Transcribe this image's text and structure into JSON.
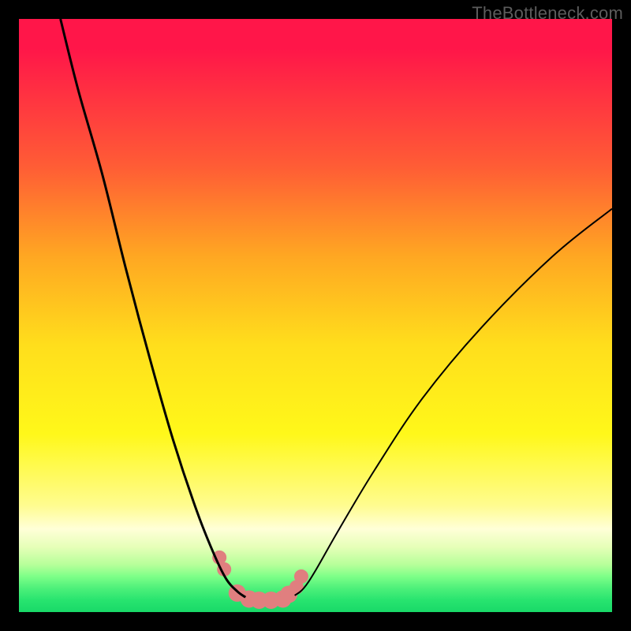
{
  "watermark": {
    "text": "TheBottleneck.com"
  },
  "chart_data": {
    "type": "line",
    "title": "",
    "xlabel": "",
    "ylabel": "",
    "xlim": [
      0,
      100
    ],
    "ylim": [
      0,
      100
    ],
    "grid": false,
    "legend": false,
    "series": [
      {
        "name": "left-curve",
        "x": [
          7,
          10,
          14,
          18,
          22,
          26,
          30,
          33,
          35,
          36.8,
          38.2
        ],
        "y": [
          100,
          88,
          74,
          58,
          43,
          29,
          17,
          9.5,
          5.5,
          3.5,
          2.5
        ]
      },
      {
        "name": "right-curve",
        "x": [
          46.5,
          48,
          50,
          54,
          60,
          68,
          78,
          90,
          100
        ],
        "y": [
          2.8,
          4,
          7,
          14,
          24,
          36,
          48,
          60,
          68
        ]
      },
      {
        "name": "valley-markers",
        "x": [
          33.8,
          34.6,
          36.8,
          38.8,
          40.5,
          42.5,
          44.5,
          45.5,
          46.8,
          47.6
        ],
        "y": [
          9.2,
          7.2,
          3.2,
          2.2,
          2.0,
          2.0,
          2.2,
          3.0,
          4.2,
          6.0
        ]
      }
    ]
  },
  "style": {
    "curve_color": "#000000",
    "curve_width_thick": 3,
    "curve_width_thin": 2,
    "marker_color": "#e07f7f",
    "marker_radius": 11,
    "marker_radius_small": 9
  }
}
